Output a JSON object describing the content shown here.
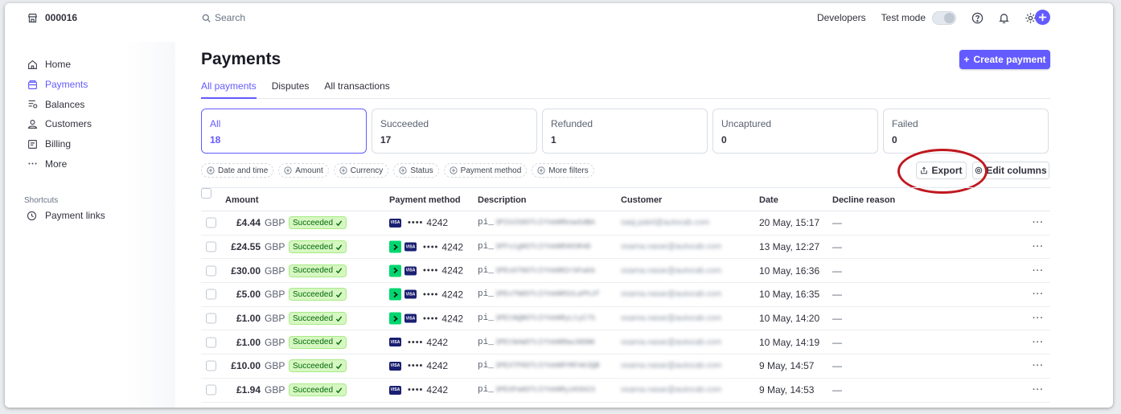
{
  "account": {
    "name": "000016",
    "icon": "store-icon"
  },
  "search": {
    "label": "Search"
  },
  "topbar": {
    "developers": "Developers",
    "test_mode": "Test mode"
  },
  "sidebar": {
    "items": [
      {
        "label": "Home",
        "icon": "home-icon",
        "active": false
      },
      {
        "label": "Payments",
        "icon": "payments-icon",
        "active": true
      },
      {
        "label": "Balances",
        "icon": "balances-icon",
        "active": false
      },
      {
        "label": "Customers",
        "icon": "customers-icon",
        "active": false
      },
      {
        "label": "Billing",
        "icon": "billing-icon",
        "active": false
      },
      {
        "label": "More",
        "icon": "more-icon",
        "active": false
      }
    ],
    "shortcuts_title": "Shortcuts",
    "shortcuts": [
      {
        "label": "Payment links",
        "icon": "clock-icon"
      }
    ]
  },
  "page": {
    "title": "Payments",
    "create_label": "Create payment"
  },
  "tabs": [
    {
      "label": "All payments",
      "active": true
    },
    {
      "label": "Disputes",
      "active": false
    },
    {
      "label": "All transactions",
      "active": false
    }
  ],
  "status_filters": [
    {
      "label": "All",
      "count": "18",
      "active": true
    },
    {
      "label": "Succeeded",
      "count": "17",
      "active": false
    },
    {
      "label": "Refunded",
      "count": "1",
      "active": false
    },
    {
      "label": "Uncaptured",
      "count": "0",
      "active": false
    },
    {
      "label": "Failed",
      "count": "0",
      "active": false
    }
  ],
  "filter_chips": [
    "Date and time",
    "Amount",
    "Currency",
    "Status",
    "Payment method",
    "More filters"
  ],
  "actions": {
    "export": "Export",
    "edit_columns": "Edit columns"
  },
  "table": {
    "columns": {
      "amount": "Amount",
      "payment_method": "Payment method",
      "description": "Description",
      "customer": "Customer",
      "date": "Date",
      "decline_reason": "Decline reason"
    },
    "rows": [
      {
        "amount": "£4.44",
        "currency": "GBP",
        "status": "Succeeded",
        "link": false,
        "last4": "4242",
        "desc_prefix": "pi_",
        "desc_rest": "3PIX2S85TcIYVeNRkowSdBA",
        "customer": "saaj.patel@autocab.com",
        "date": "20 May, 15:17",
        "decline": "—"
      },
      {
        "amount": "£24.55",
        "currency": "GBP",
        "status": "Succeeded",
        "link": true,
        "last4": "4242",
        "desc_prefix": "pi_",
        "desc_rest": "3PFx1gNSTcIYVeNRXKhR4D",
        "customer": "osama.nasar@autocab.com",
        "date": "13 May, 12:27",
        "decline": "—"
      },
      {
        "amount": "£30.00",
        "currency": "GBP",
        "status": "Succeeded",
        "link": true,
        "last4": "4242",
        "desc_prefix": "pi_",
        "desc_rest": "3PEvGTN5TcIYVeNR2rbFwkb",
        "customer": "osama.nasar@autocab.com",
        "date": "10 May, 16:36",
        "decline": "—"
      },
      {
        "amount": "£5.00",
        "currency": "GBP",
        "status": "Succeeded",
        "link": true,
        "last4": "4242",
        "desc_prefix": "pi_",
        "desc_rest": "3PEvTN85TcIYVeNRSVLePhJf",
        "customer": "osama.nasar@autocab.com",
        "date": "10 May, 16:35",
        "decline": "—"
      },
      {
        "amount": "£1.00",
        "currency": "GBP",
        "status": "Succeeded",
        "link": true,
        "last4": "4242",
        "desc_prefix": "pi_",
        "desc_rest": "3PEtNQB5TcIYVeNRyLtyC7S",
        "customer": "osama.nasar@autocab.com",
        "date": "10 May, 14:20",
        "decline": "—"
      },
      {
        "amount": "£1.00",
        "currency": "GBP",
        "status": "Succeeded",
        "link": false,
        "last4": "4242",
        "desc_prefix": "pi_",
        "desc_rest": "3PEtNAW5TcIYVeNRbwJ8DNK",
        "customer": "osama.nasar@autocab.com",
        "date": "10 May, 14:19",
        "decline": "—"
      },
      {
        "amount": "£10.00",
        "currency": "GBP",
        "status": "Succeeded",
        "link": false,
        "last4": "4242",
        "desc_prefix": "pi_",
        "desc_rest": "3PEXTP85TcIYVeNRYMFAK3QB",
        "customer": "osama.nasar@autocab.com",
        "date": "9 May, 14:57",
        "decline": "—"
      },
      {
        "amount": "£1.94",
        "currency": "GBP",
        "status": "Succeeded",
        "link": false,
        "last4": "4242",
        "desc_prefix": "pi_",
        "desc_rest": "3PEXPaN5TcIYVeNRyzKSH23",
        "customer": "osama.nasar@autocab.com",
        "date": "9 May, 14:53",
        "decline": "—"
      }
    ]
  },
  "colors": {
    "accent": "#635bff",
    "success_bg": "#d7f7c2",
    "success_text": "#006908",
    "annotation": "#c0181f"
  }
}
